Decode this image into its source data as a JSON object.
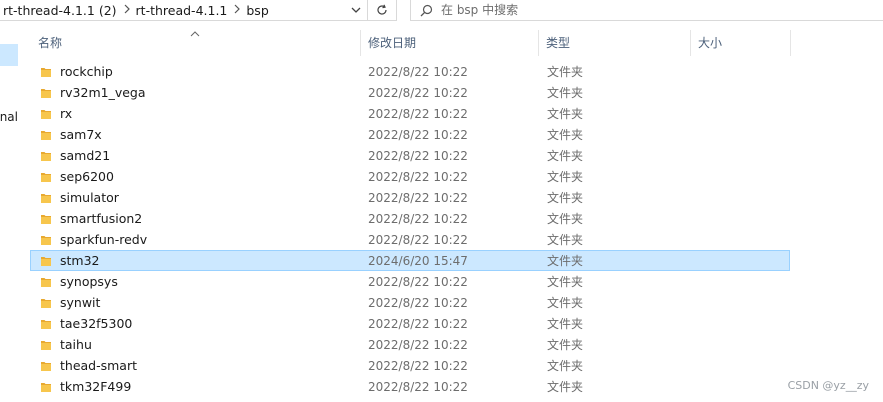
{
  "address": {
    "crumbs": [
      "rt-thread-4.1.1 (2)",
      "rt-thread-4.1.1",
      "bsp"
    ]
  },
  "search": {
    "placeholder": "在 bsp 中搜索"
  },
  "nav": {
    "partial_label": "nal"
  },
  "columns": {
    "name": "名称",
    "date": "修改日期",
    "type": "类型",
    "size": "大小"
  },
  "rows": [
    {
      "name": "rockchip",
      "date": "2022/8/22 10:22",
      "type": "文件夹"
    },
    {
      "name": "rv32m1_vega",
      "date": "2022/8/22 10:22",
      "type": "文件夹"
    },
    {
      "name": "rx",
      "date": "2022/8/22 10:22",
      "type": "文件夹"
    },
    {
      "name": "sam7x",
      "date": "2022/8/22 10:22",
      "type": "文件夹"
    },
    {
      "name": "samd21",
      "date": "2022/8/22 10:22",
      "type": "文件夹"
    },
    {
      "name": "sep6200",
      "date": "2022/8/22 10:22",
      "type": "文件夹"
    },
    {
      "name": "simulator",
      "date": "2022/8/22 10:22",
      "type": "文件夹"
    },
    {
      "name": "smartfusion2",
      "date": "2022/8/22 10:22",
      "type": "文件夹"
    },
    {
      "name": "sparkfun-redv",
      "date": "2022/8/22 10:22",
      "type": "文件夹"
    },
    {
      "name": "stm32",
      "date": "2024/6/20 15:47",
      "type": "文件夹",
      "selected": true
    },
    {
      "name": "synopsys",
      "date": "2022/8/22 10:22",
      "type": "文件夹"
    },
    {
      "name": "synwit",
      "date": "2022/8/22 10:22",
      "type": "文件夹"
    },
    {
      "name": "tae32f5300",
      "date": "2022/8/22 10:22",
      "type": "文件夹"
    },
    {
      "name": "taihu",
      "date": "2022/8/22 10:22",
      "type": "文件夹"
    },
    {
      "name": "thead-smart",
      "date": "2022/8/22 10:22",
      "type": "文件夹"
    },
    {
      "name": "tkm32F499",
      "date": "2022/8/22 10:22",
      "type": "文件夹"
    }
  ],
  "watermark": "CSDN @yz__zy",
  "colors": {
    "selection": "#cce8ff",
    "selection_border": "#99d1ff",
    "folder": "#f4c04a",
    "header_text": "#4c607a"
  }
}
